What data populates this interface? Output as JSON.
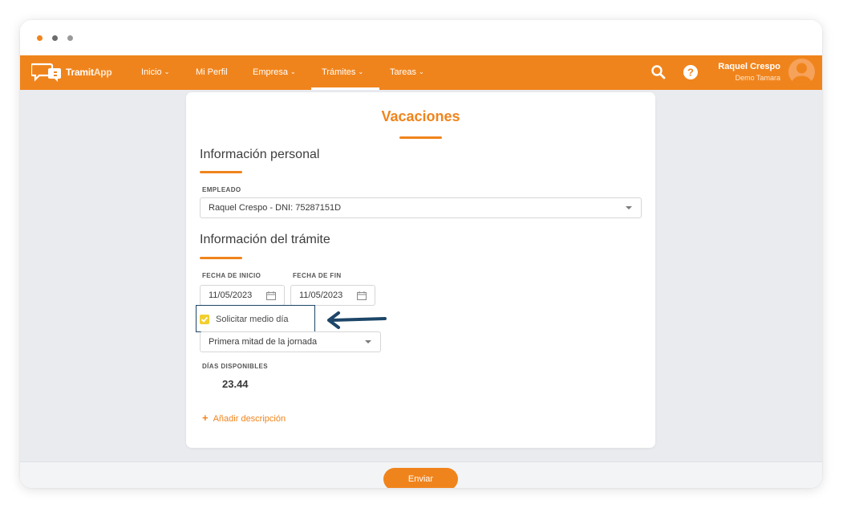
{
  "window": {
    "dots": [
      "orange",
      "dark-gray",
      "gray"
    ]
  },
  "navbar": {
    "brand": {
      "name": "Tramit",
      "suffix": "App"
    },
    "items": [
      {
        "label": "Inicio",
        "has_dropdown": true
      },
      {
        "label": "Mi Perfil",
        "has_dropdown": false
      },
      {
        "label": "Empresa",
        "has_dropdown": true
      },
      {
        "label": "Trámites",
        "has_dropdown": true,
        "active": true
      },
      {
        "label": "Tareas",
        "has_dropdown": true
      }
    ],
    "icons": [
      "search-icon",
      "help-icon"
    ],
    "user": {
      "name": "Raquel Crespo",
      "company": "Demo Tamara"
    },
    "color": "#f0841c"
  },
  "form": {
    "title": "Vacaciones",
    "personal_section": {
      "title": "Información personal",
      "employee_label": "EMPLEADO",
      "employee_value": "Raquel Crespo - DNI: 75287151D"
    },
    "procedure_section": {
      "title": "Información del trámite",
      "start_label": "FECHA DE INICIO",
      "start_value": "11/05/2023",
      "end_label": "FECHA DE FIN",
      "end_value": "11/05/2023",
      "half_day_label": "Solicitar medio día",
      "half_day_checked": true,
      "half_day_option": "Primera mitad de la jornada",
      "days_label": "DÍAS DISPONIBLES",
      "days_value": "23.44",
      "add_description": "Añadir descripción"
    }
  },
  "footer": {
    "submit_label": "Enviar"
  },
  "colors": {
    "accent": "#f0841c",
    "highlight_border": "#1d4668",
    "checkbox": "#f2cf2f",
    "background": "#e9ebef"
  }
}
